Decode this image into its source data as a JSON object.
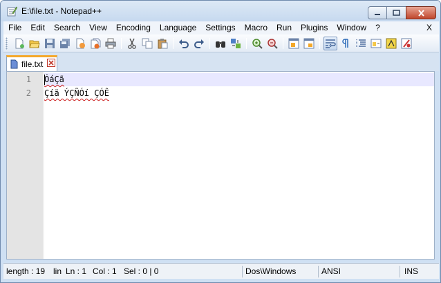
{
  "window": {
    "title": "E:\\file.txt - Notepad++"
  },
  "menu": {
    "items": [
      "File",
      "Edit",
      "Search",
      "View",
      "Encoding",
      "Language",
      "Settings",
      "Macro",
      "Run",
      "Plugins",
      "Window",
      "?"
    ],
    "close_label": "X"
  },
  "toolbar": {
    "buttons": [
      "new-file-icon",
      "open-file-icon",
      "save-icon",
      "save-all-icon",
      "close-icon",
      "close-all-icon",
      "print-icon",
      "cut-icon",
      "copy-icon",
      "paste-icon",
      "undo-icon",
      "redo-icon",
      "find-icon",
      "replace-icon",
      "zoom-in-icon",
      "zoom-out-icon",
      "sync-v-icon",
      "sync-h-icon",
      "word-wrap-icon",
      "show-all-chars-icon",
      "indent-guide-icon",
      "fold-icon",
      "macro-record-icon",
      "macro-stop-icon"
    ]
  },
  "tabs": [
    {
      "label": "file.txt"
    }
  ],
  "editor": {
    "lines": [
      {
        "number": "1",
        "text": "ÓáÇã"
      },
      {
        "number": "2",
        "text": "Çíä ÝÇÑÓí ÇÓÊ"
      }
    ]
  },
  "status": {
    "length": "length : 19",
    "lines": "lin",
    "ln": "Ln : 1",
    "col": "Col : 1",
    "sel": "Sel : 0 | 0",
    "eol": "Dos\\Windows",
    "encoding": "ANSI",
    "mode": "INS"
  },
  "colors": {
    "tab_accent": "#f4a82a",
    "current_line": "#e8e8ff",
    "gutter": "#e4e4e4"
  }
}
